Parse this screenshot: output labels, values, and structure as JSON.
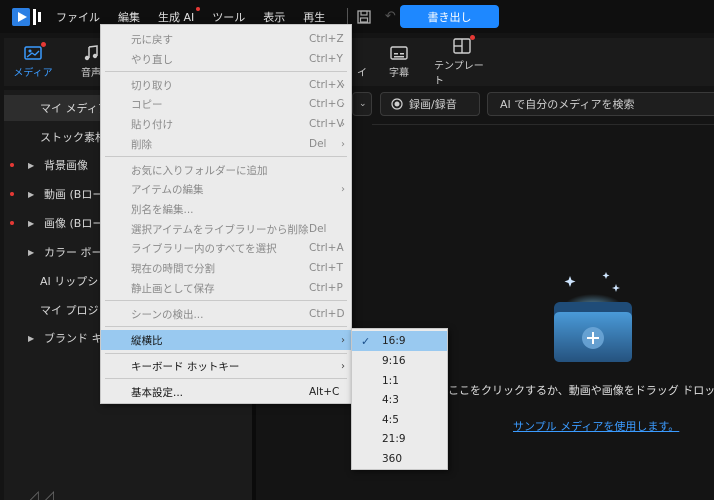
{
  "menubar": {
    "items": [
      "ファイル",
      "編集",
      "生成 AI",
      "ツール",
      "表示",
      "再生"
    ],
    "export_label": "書き出し"
  },
  "tabs": [
    {
      "label": "メディア",
      "active": true
    },
    {
      "label": "音声"
    },
    {
      "label": "イ"
    },
    {
      "label": "字幕"
    },
    {
      "label": "テンプレート"
    }
  ],
  "left_panel": {
    "items": [
      {
        "label": "マイ メディア",
        "active": true
      },
      {
        "label": "ストック素材"
      },
      {
        "label": "背景画像"
      },
      {
        "label": "動画 (Bロール"
      },
      {
        "label": "画像 (Bロール"
      },
      {
        "label": "カラー ボード"
      },
      {
        "label": "AI リップシンク"
      },
      {
        "label": "マイ プロジェク"
      },
      {
        "label": "ブランド キット"
      }
    ]
  },
  "toolbar": {
    "record_label": "録画/録音",
    "search_placeholder": "AI で自分のメディアを検索"
  },
  "content": {
    "drop_text": "ここをクリックするか、動画や画像をドラッグ ドロップします",
    "sample_link": "サンプル メディアを使用します。"
  },
  "context_menu": {
    "items": [
      {
        "label": "元に戻す",
        "shortcut": "Ctrl+Z",
        "disabled": true
      },
      {
        "label": "やり直し",
        "shortcut": "Ctrl+Y",
        "disabled": true
      },
      {
        "label": "切り取り",
        "shortcut": "Ctrl+X",
        "disabled": true,
        "arrow": true
      },
      {
        "label": "コピー",
        "shortcut": "Ctrl+C",
        "disabled": true,
        "arrow": true
      },
      {
        "label": "貼り付け",
        "shortcut": "Ctrl+V",
        "disabled": true,
        "arrow": true
      },
      {
        "label": "削除",
        "shortcut": "Del",
        "disabled": true,
        "arrow": true
      },
      {
        "label": "お気に入りフォルダーに追加",
        "disabled": true
      },
      {
        "label": "アイテムの編集",
        "disabled": true,
        "arrow": true
      },
      {
        "label": "別名を編集...",
        "disabled": true
      },
      {
        "label": "選択アイテムをライブラリーから削除",
        "shortcut": "Del",
        "disabled": true
      },
      {
        "label": "ライブラリー内のすべてを選択",
        "shortcut": "Ctrl+A",
        "disabled": true
      },
      {
        "label": "現在の時間で分割",
        "shortcut": "Ctrl+T",
        "disabled": true
      },
      {
        "label": "静止画として保存",
        "shortcut": "Ctrl+P",
        "disabled": true
      },
      {
        "label": "シーンの検出...",
        "shortcut": "Ctrl+D",
        "disabled": true
      },
      {
        "label": "縦横比",
        "arrow": true,
        "highlighted": true
      },
      {
        "label": "キーボード ホットキー",
        "arrow": true
      },
      {
        "label": "基本設定...",
        "shortcut": "Alt+C"
      }
    ]
  },
  "aspect_submenu": {
    "items": [
      "16:9",
      "9:16",
      "1:1",
      "4:3",
      "4:5",
      "21:9",
      "360"
    ],
    "selected": "16:9"
  }
}
